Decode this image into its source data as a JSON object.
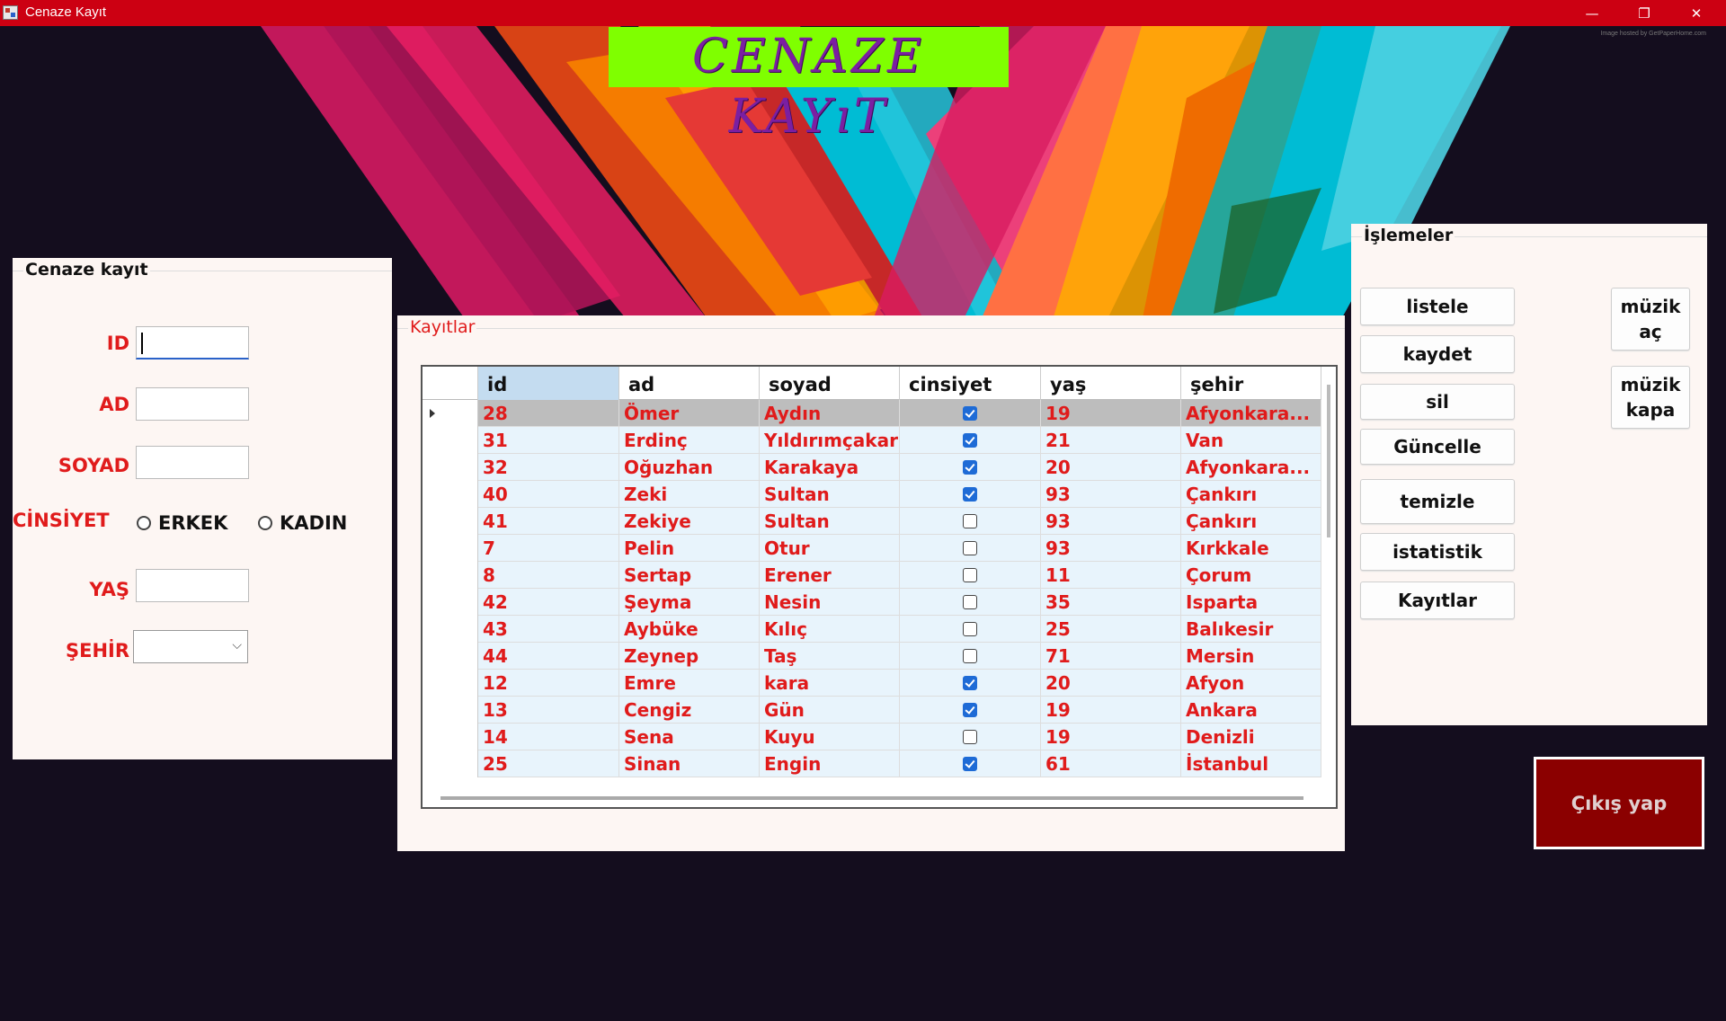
{
  "window": {
    "title": "Cenaze Kayıt",
    "minimize": "—",
    "restore": "❐",
    "close": "✕",
    "watermark": "Image hosted by GetPaperHome.com"
  },
  "logo": {
    "text": "CENAZE KAYıT"
  },
  "form": {
    "title": "Cenaze kayıt",
    "id_label": "ID",
    "ad_label": "AD",
    "soyad_label": "SOYAD",
    "cinsiyet_label": "CİNSİYET",
    "erkek": "ERKEK",
    "kadin": "KADIN",
    "yas_label": "YAŞ",
    "sehir_label": "ŞEHİR"
  },
  "records": {
    "title": "Kayıtlar",
    "columns": [
      "id",
      "ad",
      "soyad",
      "cinsiyet",
      "yaş",
      "şehir"
    ],
    "rows": [
      {
        "id": "28",
        "ad": "Ömer",
        "soyad": "Aydın",
        "cinsiyet": true,
        "yas": "19",
        "sehir": "Afyonkara..."
      },
      {
        "id": "31",
        "ad": "Erdinç",
        "soyad": "Yıldırımçakar",
        "cinsiyet": true,
        "yas": "21",
        "sehir": "Van"
      },
      {
        "id": "32",
        "ad": "Oğuzhan",
        "soyad": "Karakaya",
        "cinsiyet": true,
        "yas": "20",
        "sehir": "Afyonkara..."
      },
      {
        "id": "40",
        "ad": "Zeki",
        "soyad": "Sultan",
        "cinsiyet": true,
        "yas": "93",
        "sehir": "Çankırı"
      },
      {
        "id": "41",
        "ad": "Zekiye",
        "soyad": "Sultan",
        "cinsiyet": false,
        "yas": "93",
        "sehir": "Çankırı"
      },
      {
        "id": "7",
        "ad": "Pelin",
        "soyad": "Otur",
        "cinsiyet": false,
        "yas": "93",
        "sehir": "Kırkkale"
      },
      {
        "id": "8",
        "ad": "Sertap",
        "soyad": "Erener",
        "cinsiyet": false,
        "yas": "11",
        "sehir": "Çorum"
      },
      {
        "id": "42",
        "ad": "Şeyma",
        "soyad": "Nesin",
        "cinsiyet": false,
        "yas": "35",
        "sehir": "Isparta"
      },
      {
        "id": "43",
        "ad": "Aybüke",
        "soyad": "Kılıç",
        "cinsiyet": false,
        "yas": "25",
        "sehir": "Balıkesir"
      },
      {
        "id": "44",
        "ad": "Zeynep",
        "soyad": "Taş",
        "cinsiyet": false,
        "yas": "71",
        "sehir": "Mersin"
      },
      {
        "id": "12",
        "ad": "Emre",
        "soyad": "kara",
        "cinsiyet": true,
        "yas": "20",
        "sehir": "Afyon"
      },
      {
        "id": "13",
        "ad": "Cengiz",
        "soyad": "Gün",
        "cinsiyet": true,
        "yas": "19",
        "sehir": "Ankara"
      },
      {
        "id": "14",
        "ad": "Sena",
        "soyad": "Kuyu",
        "cinsiyet": false,
        "yas": "19",
        "sehir": "Denizli"
      },
      {
        "id": "25",
        "ad": "Sinan",
        "soyad": "Engin",
        "cinsiyet": true,
        "yas": "61",
        "sehir": "İstanbul"
      }
    ]
  },
  "ops": {
    "title": "İşlemeler",
    "listele": "listele",
    "kaydet": "kaydet",
    "sil": "sil",
    "guncelle": "Güncelle",
    "temizle": "temizle",
    "istatistik": "istatistik",
    "kayitlar": "Kayıtlar",
    "muzik_ac": "müzik aç",
    "muzik_kapa": "müzik kapa"
  },
  "exit": {
    "label": "Çıkış yap"
  },
  "colors": {
    "titlebar": "#cc0012",
    "accent": "#e01b1b",
    "exit": "#8b0000",
    "logo_bg": "#7fff00",
    "logo_text": "#7b1fa2"
  }
}
